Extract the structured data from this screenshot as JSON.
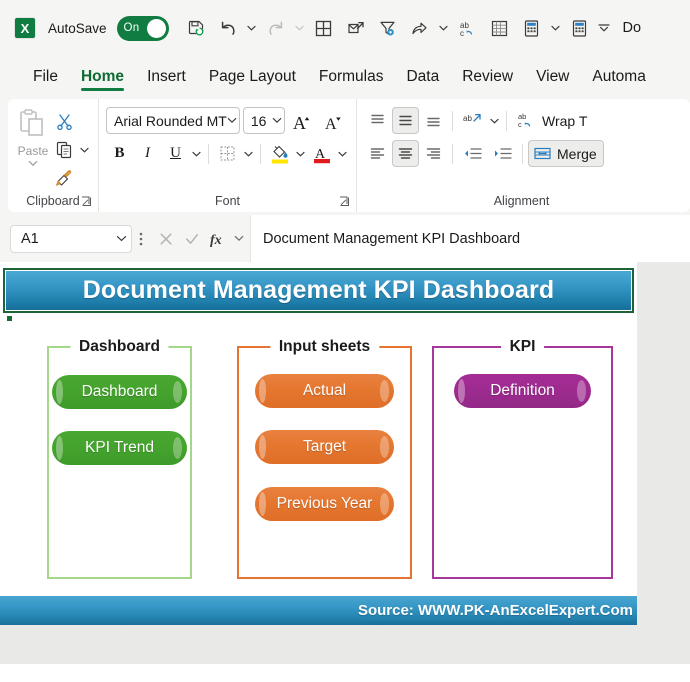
{
  "quick_access": {
    "app_icon": "excel-logo-icon",
    "autosave_label": "AutoSave",
    "autosave_state": "On",
    "buttons": [
      {
        "name": "save-icon",
        "label": "Save"
      },
      {
        "name": "undo-icon",
        "label": "Undo"
      },
      {
        "name": "redo-icon",
        "label": "Redo"
      },
      {
        "name": "table-icon",
        "label": "Table"
      },
      {
        "name": "attach-send-icon",
        "label": "Send"
      },
      {
        "name": "filter-settings-icon",
        "label": "Filter"
      },
      {
        "name": "share-icon",
        "label": "Share"
      },
      {
        "name": "spelling-icon",
        "label": "Spelling"
      },
      {
        "name": "sheet-grid-icon",
        "label": "Sheet"
      },
      {
        "name": "calculator-icon",
        "label": "Calculator"
      },
      {
        "name": "calculator-alt-icon",
        "label": "Calculate Now"
      },
      {
        "name": "customize-qat-icon",
        "label": "Customize Quick Access Toolbar"
      }
    ],
    "document_title": "Do"
  },
  "ribbon_tabs": [
    {
      "label": "File",
      "active": false
    },
    {
      "label": "Home",
      "active": true
    },
    {
      "label": "Insert",
      "active": false
    },
    {
      "label": "Page Layout",
      "active": false
    },
    {
      "label": "Formulas",
      "active": false
    },
    {
      "label": "Data",
      "active": false
    },
    {
      "label": "Review",
      "active": false
    },
    {
      "label": "View",
      "active": false
    },
    {
      "label": "Automa",
      "active": false
    }
  ],
  "ribbon": {
    "clipboard": {
      "group_label": "Clipboard",
      "paste_label": "Paste",
      "cut_label": "Cut",
      "copy_label": "Copy",
      "format_painter_label": "Format Painter"
    },
    "font": {
      "group_label": "Font",
      "font_name": "Arial Rounded MT",
      "font_size": "16",
      "increase_font_label": "A",
      "decrease_font_label": "A",
      "bold_label": "B",
      "italic_label": "I",
      "underline_label": "U"
    },
    "alignment": {
      "group_label": "Alignment",
      "wrap_text_label": "Wrap T",
      "merge_label": "Merge"
    }
  },
  "formula_bar": {
    "name_box": "A1",
    "cancel_icon": "cancel-icon",
    "enter_icon": "check-icon",
    "function_icon": "fx-icon",
    "content": "Document Management KPI Dashboard"
  },
  "worksheet": {
    "title_banner": "Document Management KPI Dashboard",
    "groups": [
      {
        "id": "dashboard",
        "label": "Dashboard",
        "color": "#a4d78a",
        "buttons": [
          {
            "label": "Dashboard"
          },
          {
            "label": "KPI Trend"
          }
        ]
      },
      {
        "id": "input-sheets",
        "label": "Input sheets",
        "color": "#e57332",
        "buttons": [
          {
            "label": "Actual"
          },
          {
            "label": "Target"
          },
          {
            "label": "Previous Year"
          }
        ]
      },
      {
        "id": "kpi",
        "label": "KPI",
        "color": "#a8379c",
        "buttons": [
          {
            "label": "Definition"
          }
        ]
      }
    ],
    "source_text": "Source: WWW.PK-AnExcelExpert.Com"
  }
}
